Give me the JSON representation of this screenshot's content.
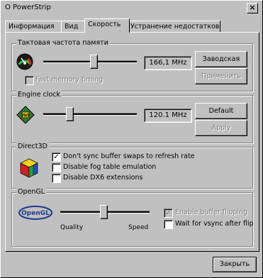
{
  "window": {
    "title": "О PowerStrip",
    "close_glyph": "×"
  },
  "tabs": [
    {
      "label": "Информация"
    },
    {
      "label": "Вид"
    },
    {
      "label": "Скорость"
    },
    {
      "label": "Устранение недостатков"
    }
  ],
  "memory_clock": {
    "group_label": "Тактовая частота памяти",
    "value": "166,1 MHz",
    "default_button": "Заводская",
    "apply_button": "Применить",
    "fast_timing_label": "Fast memory timing",
    "fast_timing_checked": false
  },
  "engine_clock": {
    "group_label": "Engine clock",
    "value": "120.1 MHz",
    "default_button": "Default",
    "apply_button": "Apply"
  },
  "direct3d": {
    "group_label": "Direct3D",
    "options": [
      {
        "label": "Don't sync buffer swaps to refresh rate",
        "checked": true
      },
      {
        "label": "Disable fog table emulation",
        "checked": false
      },
      {
        "label": "Disable DX6 extensions",
        "checked": false
      }
    ]
  },
  "opengl": {
    "group_label": "OpenGL",
    "logo_text": "OpenGL",
    "slider_left": "Quality",
    "slider_right": "Speed",
    "options": [
      {
        "label": "Enable buffer flipping",
        "checked": true,
        "disabled": true
      },
      {
        "label": "Wait for vsync after flip",
        "checked": false,
        "disabled": false
      }
    ]
  },
  "footer": {
    "close_button": "Закрыть"
  }
}
